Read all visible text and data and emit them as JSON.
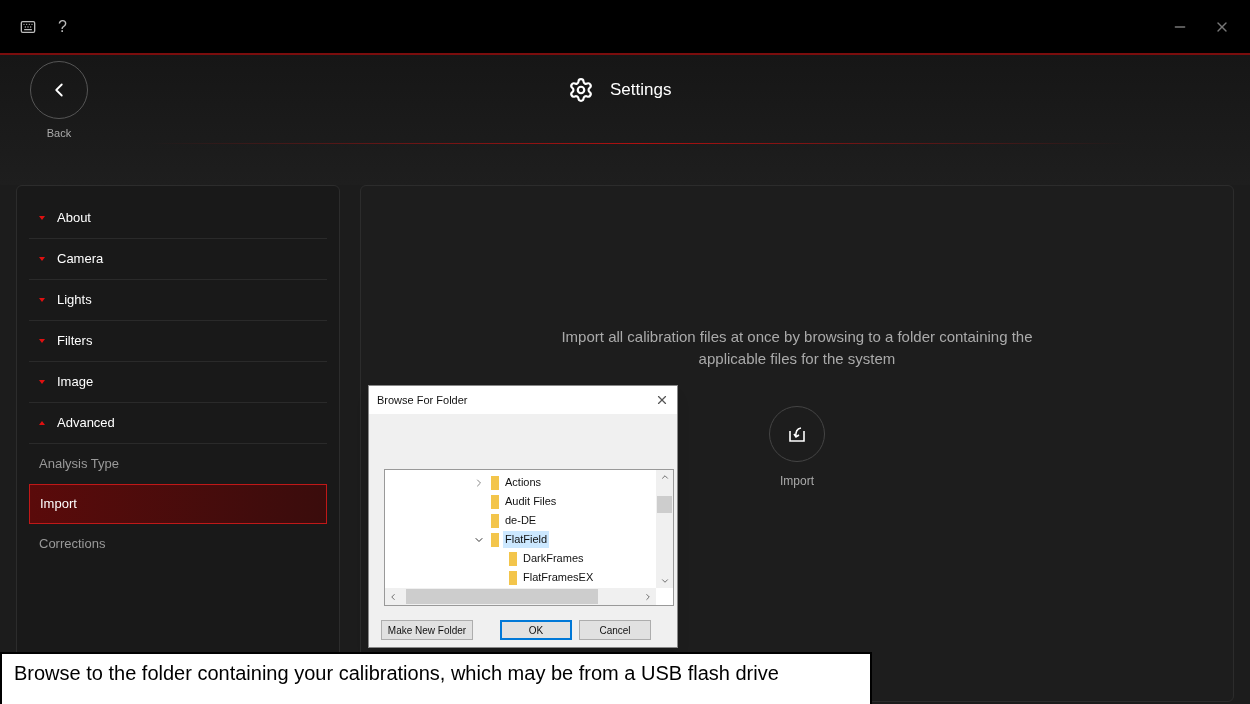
{
  "top_bar": {
    "help": "?"
  },
  "header": {
    "back_label": "Back",
    "title": "Settings"
  },
  "sidebar": {
    "items": [
      {
        "kind": "section",
        "label": "About",
        "expanded": false
      },
      {
        "kind": "section",
        "label": "Camera",
        "expanded": false
      },
      {
        "kind": "section",
        "label": "Lights",
        "expanded": false
      },
      {
        "kind": "section",
        "label": "Filters",
        "expanded": false
      },
      {
        "kind": "section",
        "label": "Image",
        "expanded": false
      },
      {
        "kind": "section",
        "label": "Advanced",
        "expanded": true
      },
      {
        "kind": "sub",
        "label": "Analysis Type",
        "selected": false
      },
      {
        "kind": "sub",
        "label": "Import",
        "selected": true
      },
      {
        "kind": "sub",
        "label": "Corrections",
        "selected": false
      }
    ]
  },
  "main": {
    "description": "Import all calibration files at once by browsing to a folder containing the applicable files for the system",
    "import_label": "Import"
  },
  "dialog": {
    "title": "Browse For Folder",
    "tree": [
      {
        "label": "Actions",
        "kind": "branch",
        "expanded": false,
        "selected": false
      },
      {
        "label": "Audit Files",
        "kind": "leaf",
        "selected": false
      },
      {
        "label": "de-DE",
        "kind": "leaf",
        "selected": false
      },
      {
        "label": "FlatField",
        "kind": "branch",
        "expanded": true,
        "selected": true,
        "children": [
          {
            "label": "DarkFrames",
            "kind": "leaf",
            "selected": false
          },
          {
            "label": "FlatFramesEX",
            "kind": "leaf",
            "selected": false
          }
        ]
      }
    ],
    "buttons": [
      {
        "label": "Make New Folder",
        "default": false
      },
      {
        "label": "OK",
        "default": true
      },
      {
        "label": "Cancel",
        "default": false
      }
    ]
  },
  "caption": "Browse to the folder containing your calibrations, which may be from a USB flash drive"
}
